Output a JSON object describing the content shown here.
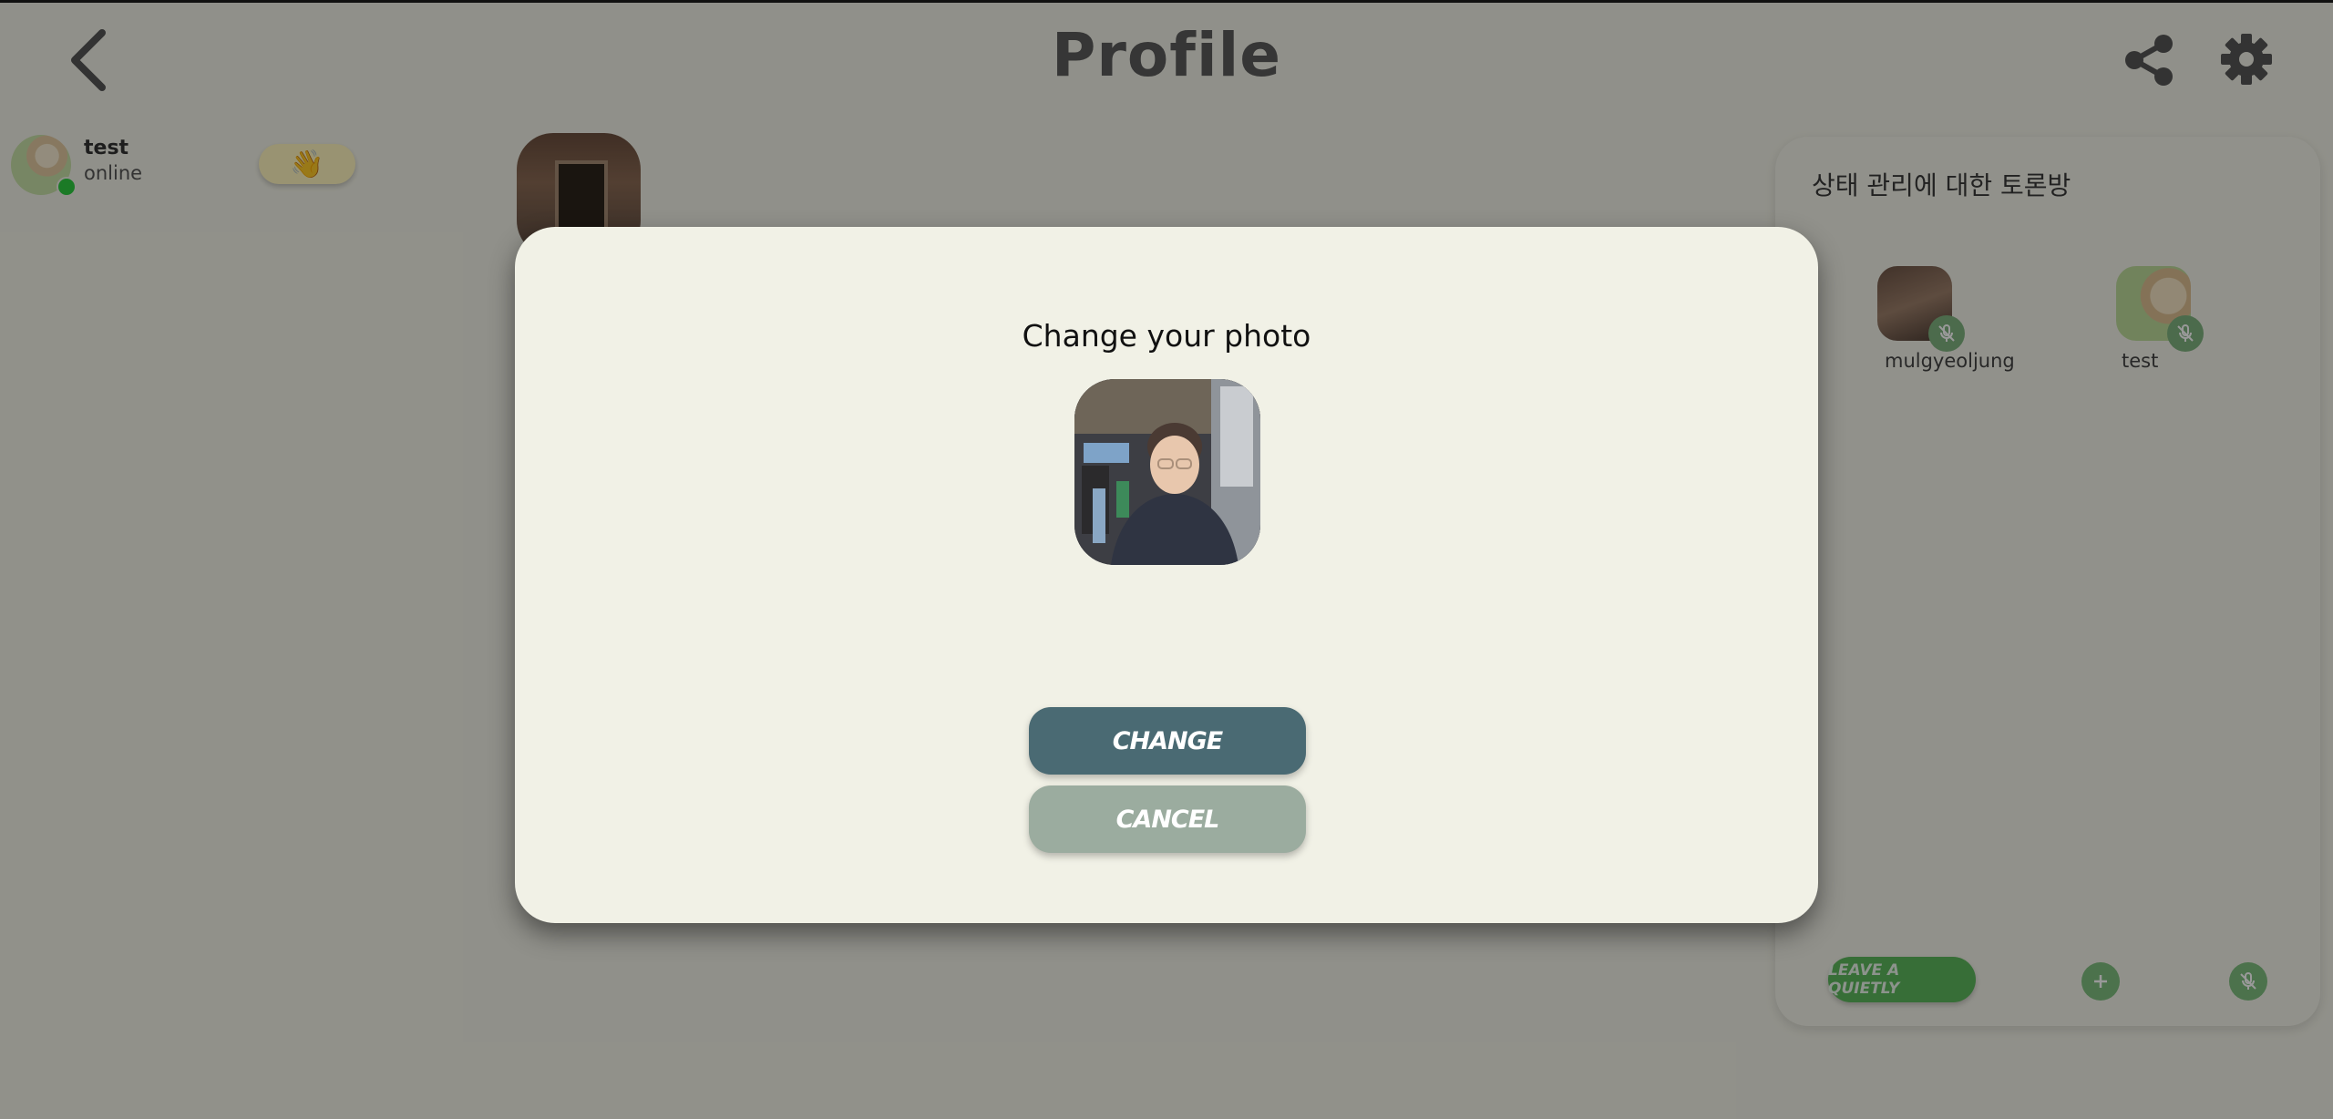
{
  "header": {
    "title": "Profile"
  },
  "user": {
    "name": "test",
    "status": "online"
  },
  "room": {
    "title": "상태 관리에 대한 토론방",
    "participants": [
      {
        "name": "mulgyeoljung"
      },
      {
        "name": "test"
      }
    ],
    "leave_label": "LEAVE A QUIETLY"
  },
  "modal": {
    "title": "Change your photo",
    "change_label": "CHANGE",
    "cancel_label": "CANCEL"
  },
  "colors": {
    "change_button": "#4a6a73",
    "cancel_button": "#9bac9f",
    "modal_background": "#f1f1e6",
    "online_indicator": "#2ecc40"
  },
  "icons": {
    "back": "chevron-left-icon",
    "share": "share-icon",
    "settings": "gear-icon",
    "wave": "waving-hand-icon",
    "mute": "microphone-off-icon",
    "add": "plus-icon"
  }
}
